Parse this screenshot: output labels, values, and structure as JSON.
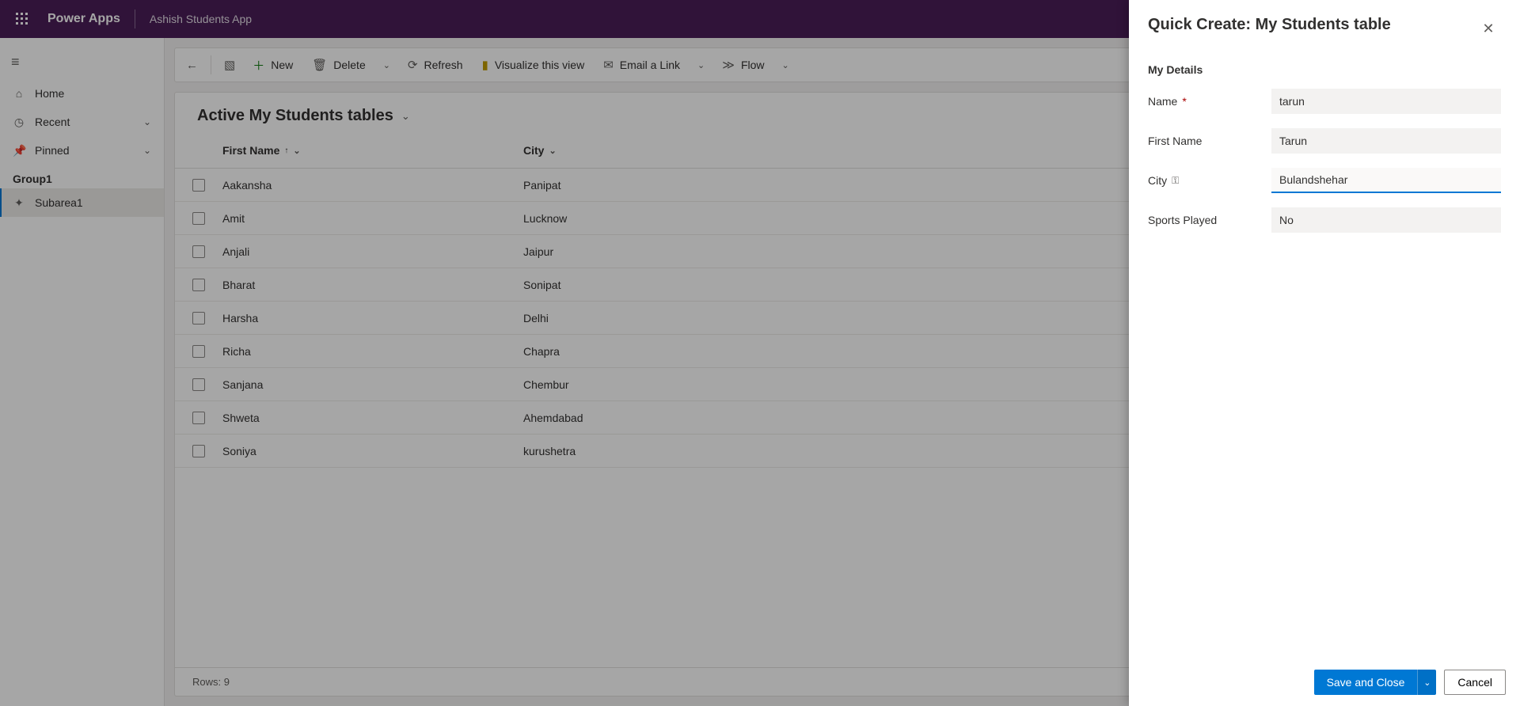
{
  "header": {
    "app": "Power Apps",
    "page": "Ashish Students App"
  },
  "nav": {
    "home": "Home",
    "recent": "Recent",
    "pinned": "Pinned",
    "group": "Group1",
    "subarea": "Subarea1"
  },
  "commands": {
    "new": "New",
    "delete": "Delete",
    "refresh": "Refresh",
    "visualize": "Visualize this view",
    "email": "Email a Link",
    "flow": "Flow"
  },
  "grid": {
    "title": "Active My Students tables",
    "columns": {
      "first": "First Name",
      "city": "City"
    },
    "rows": [
      {
        "first": "Aakansha",
        "city": "Panipat"
      },
      {
        "first": "Amit",
        "city": "Lucknow"
      },
      {
        "first": "Anjali",
        "city": "Jaipur"
      },
      {
        "first": "Bharat",
        "city": "Sonipat"
      },
      {
        "first": "Harsha",
        "city": "Delhi"
      },
      {
        "first": "Richa",
        "city": "Chapra"
      },
      {
        "first": "Sanjana",
        "city": "Chembur"
      },
      {
        "first": "Shweta",
        "city": "Ahemdabad"
      },
      {
        "first": "Soniya",
        "city": "kurushetra"
      }
    ],
    "footer": "Rows: 9"
  },
  "panel": {
    "title": "Quick Create: My Students table",
    "section": "My Details",
    "fields": {
      "name_label": "Name",
      "name_value": "tarun",
      "first_label": "First Name",
      "first_value": "Tarun",
      "city_label": "City",
      "city_value": "Bulandshehar",
      "sports_label": "Sports Played",
      "sports_value": "No"
    },
    "save": "Save and Close",
    "cancel": "Cancel"
  }
}
